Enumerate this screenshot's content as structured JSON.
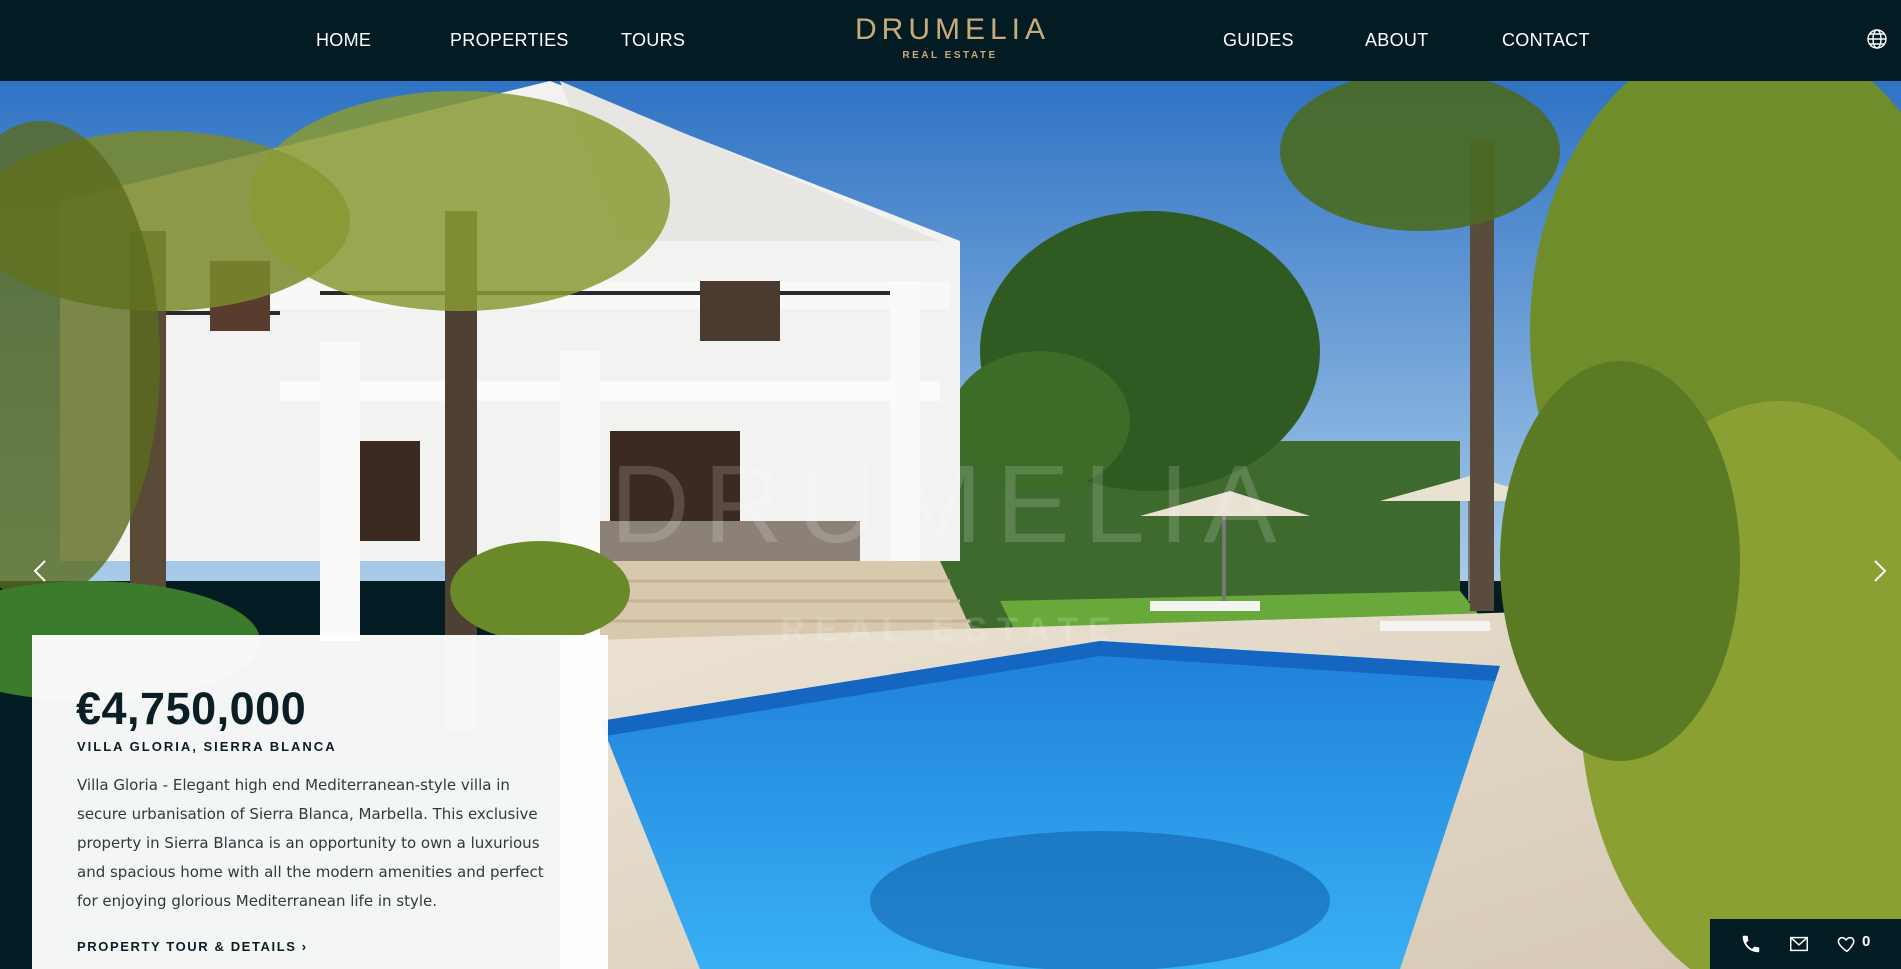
{
  "brand": {
    "name": "DRUMELIA",
    "tagline": "REAL ESTATE"
  },
  "nav": {
    "home": "HOME",
    "properties": "PROPERTIES",
    "tours": "TOURS",
    "guides": "GUIDES",
    "about": "ABOUT",
    "contact": "CONTACT"
  },
  "icons": {
    "language": "globe-icon",
    "prev": "chevron-left-icon",
    "next": "chevron-right-icon",
    "phone": "phone-icon",
    "email": "mail-icon",
    "favorites": "heart-icon"
  },
  "hero": {
    "watermark_main": "DRUMELIA",
    "watermark_sub": "REAL ESTATE"
  },
  "listing": {
    "price": "€4,750,000",
    "name": "VILLA GLORIA, SIERRA BLANCA",
    "description": "Villa Gloria - Elegant high end Mediterranean-style villa in secure urbanisation of Sierra Blanca, Marbella. This exclusive property in Sierra Blanca is an opportunity to own a luxurious and spacious home with all the modern amenities and perfect for enjoying glorious Mediterranean life in style.",
    "cta": "PROPERTY TOUR & DETAILS ›"
  },
  "contact_bar": {
    "favorites_count": "0"
  },
  "colors": {
    "header_bg": "#031c24",
    "brand_gold": "#c9ab7a",
    "pool_blue": "#1a8fe0"
  }
}
